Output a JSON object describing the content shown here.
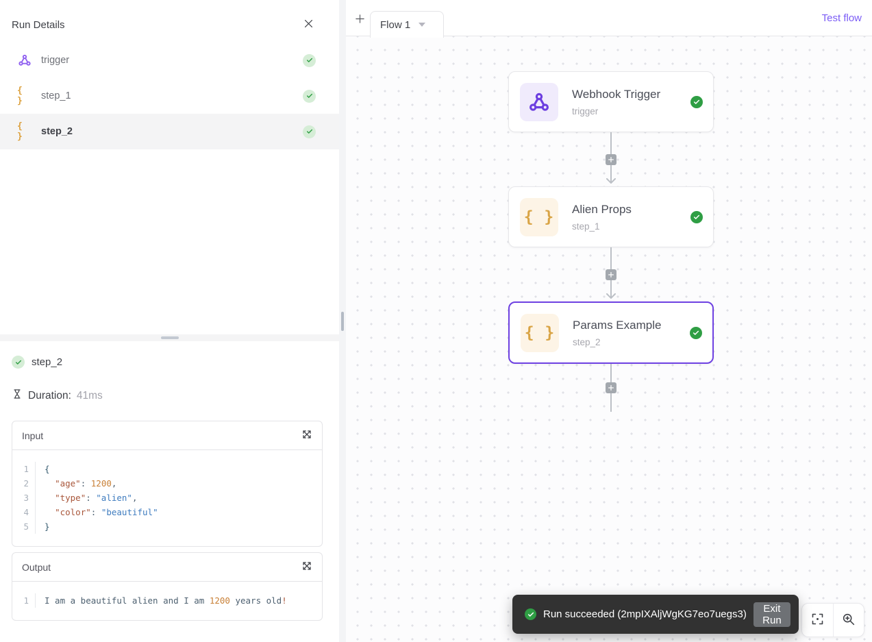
{
  "panel": {
    "title": "Run Details",
    "steps": [
      {
        "label": "trigger",
        "icon": "webhook-icon",
        "status": "success"
      },
      {
        "label": "step_1",
        "icon": "braces-icon",
        "status": "success"
      },
      {
        "label": "step_2",
        "icon": "braces-icon",
        "status": "success",
        "selected": true
      }
    ],
    "detail": {
      "step_label": "step_2",
      "duration_label": "Duration:",
      "duration_value": "41ms",
      "input": {
        "label": "Input",
        "lines": [
          [
            {
              "t": "brace",
              "v": "{"
            }
          ],
          [
            {
              "t": "plain",
              "v": "  "
            },
            {
              "t": "key",
              "v": "\"age\""
            },
            {
              "t": "punct",
              "v": ": "
            },
            {
              "t": "num",
              "v": "1200"
            },
            {
              "t": "punct",
              "v": ","
            }
          ],
          [
            {
              "t": "plain",
              "v": "  "
            },
            {
              "t": "key",
              "v": "\"type\""
            },
            {
              "t": "punct",
              "v": ": "
            },
            {
              "t": "str",
              "v": "\"alien\""
            },
            {
              "t": "punct",
              "v": ","
            }
          ],
          [
            {
              "t": "plain",
              "v": "  "
            },
            {
              "t": "key",
              "v": "\"color\""
            },
            {
              "t": "punct",
              "v": ": "
            },
            {
              "t": "str",
              "v": "\"beautiful\""
            }
          ],
          [
            {
              "t": "brace",
              "v": "}"
            }
          ]
        ]
      },
      "output": {
        "label": "Output",
        "lines": [
          [
            {
              "t": "plain",
              "v": "I am a beautiful alien and I am "
            },
            {
              "t": "num",
              "v": "1200"
            },
            {
              "t": "plain",
              "v": " years old"
            },
            {
              "t": "key",
              "v": "!"
            }
          ]
        ]
      }
    }
  },
  "canvas": {
    "tab_label": "Flow 1",
    "test_flow_label": "Test flow",
    "nodes": [
      {
        "title": "Webhook Trigger",
        "subtitle": "trigger",
        "icon": "webhook-icon",
        "status": "success"
      },
      {
        "title": "Alien Props",
        "subtitle": "step_1",
        "icon": "braces-icon",
        "status": "success"
      },
      {
        "title": "Params Example",
        "subtitle": "step_2",
        "icon": "braces-icon",
        "status": "success",
        "selected": true
      }
    ],
    "toast": {
      "message": "Run succeeded (2mpIXAljWgKG7eo7uegs3)",
      "button_label": "Exit Run"
    }
  },
  "colors": {
    "accent_purple": "#7b5cf6",
    "selected_node_border": "#6e41e2",
    "success_green": "#2f9e44",
    "webhook_purple": "#6d3fe0",
    "braces_gold": "#dca13f",
    "code_key": "#a8563a",
    "code_string": "#3f7cbf",
    "code_number": "#c87f35"
  }
}
